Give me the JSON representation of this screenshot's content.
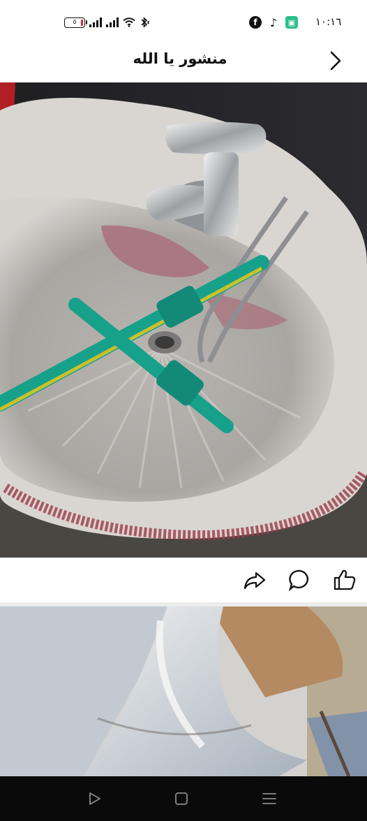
{
  "status_bar": {
    "time": "١٠:١٦",
    "battery_level": "٥",
    "app_icons": [
      "facebook-icon",
      "tiktok-icon",
      "green-app-icon"
    ],
    "system_icons": [
      "battery-icon",
      "signal-icon",
      "signal-icon",
      "wifi-icon",
      "bluetooth-icon"
    ]
  },
  "header": {
    "title": "منشور يا الله",
    "back_icon": "chevron-right-icon"
  },
  "post": {
    "images": [
      {
        "subject": "sink-with-pipes-photo"
      },
      {
        "subject": "toilet-photo"
      }
    ],
    "actions": [
      "share-icon",
      "comment-icon",
      "like-icon"
    ]
  },
  "nav_bar": {
    "buttons": [
      "play-icon",
      "square-icon",
      "menu-icon"
    ]
  }
}
